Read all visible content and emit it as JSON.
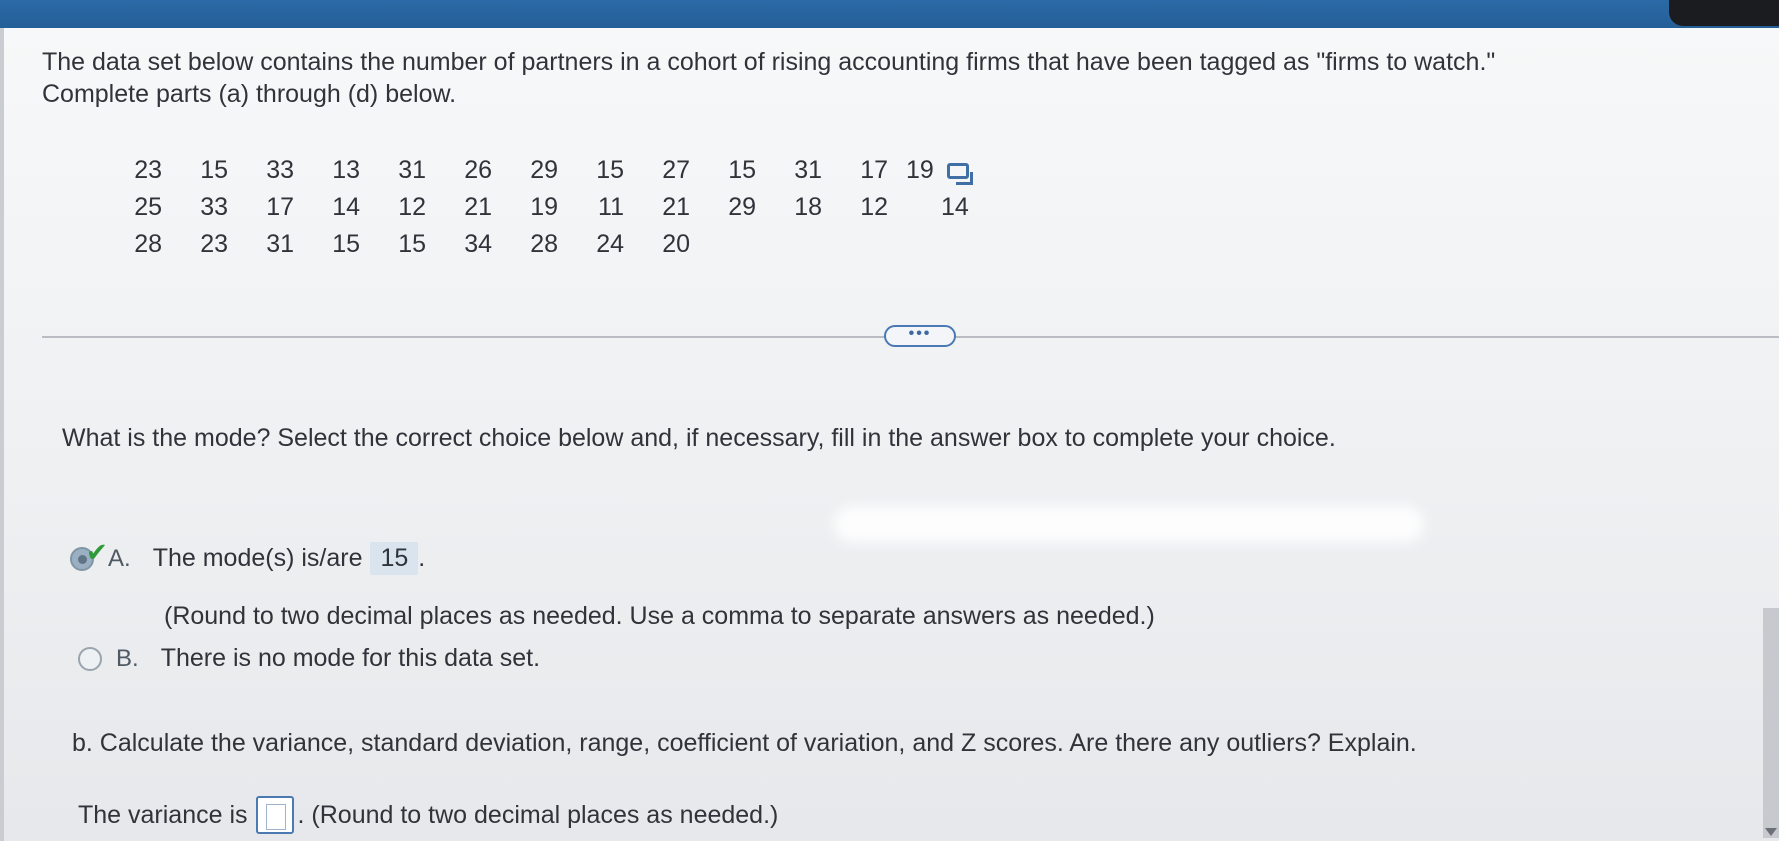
{
  "intro": {
    "line1": "The data set below contains the number of partners in a cohort of rising accounting firms that have been tagged as \"firms to watch.\"",
    "line2": "Complete parts (a) through (d) below."
  },
  "data_rows": [
    [
      "23",
      "15",
      "33",
      "13",
      "31",
      "26",
      "29",
      "15",
      "27",
      "15",
      "31",
      "17",
      "19"
    ],
    [
      "25",
      "33",
      "17",
      "14",
      "12",
      "21",
      "19",
      "11",
      "21",
      "29",
      "18",
      "12",
      "14"
    ],
    [
      "28",
      "23",
      "31",
      "15",
      "15",
      "34",
      "28",
      "24",
      "20"
    ]
  ],
  "more_button": "•••",
  "question": "What is the mode? Select the correct choice below and, if necessary, fill in the answer box to complete your choice.",
  "choice_a": {
    "letter": "A.",
    "text": "The mode(s) is/are",
    "answer": "15",
    "suffix": ".",
    "hint": "(Round to two decimal places as needed. Use a comma to separate answers as needed.)"
  },
  "choice_b": {
    "letter": "B.",
    "text": "There is no mode for this data set."
  },
  "part_b": "b. Calculate the variance, standard deviation, range, coefficient of variation, and Z scores. Are there any outliers? Explain.",
  "variance": {
    "label": "The variance is",
    "suffix": ". (Round to two decimal places as needed.)"
  },
  "icons": {
    "copy": "copy-data-icon",
    "check": "checkmark-icon"
  },
  "colors": {
    "header": "#2b6aa6",
    "accent": "#4a79b3",
    "check": "#2f9a3a"
  }
}
